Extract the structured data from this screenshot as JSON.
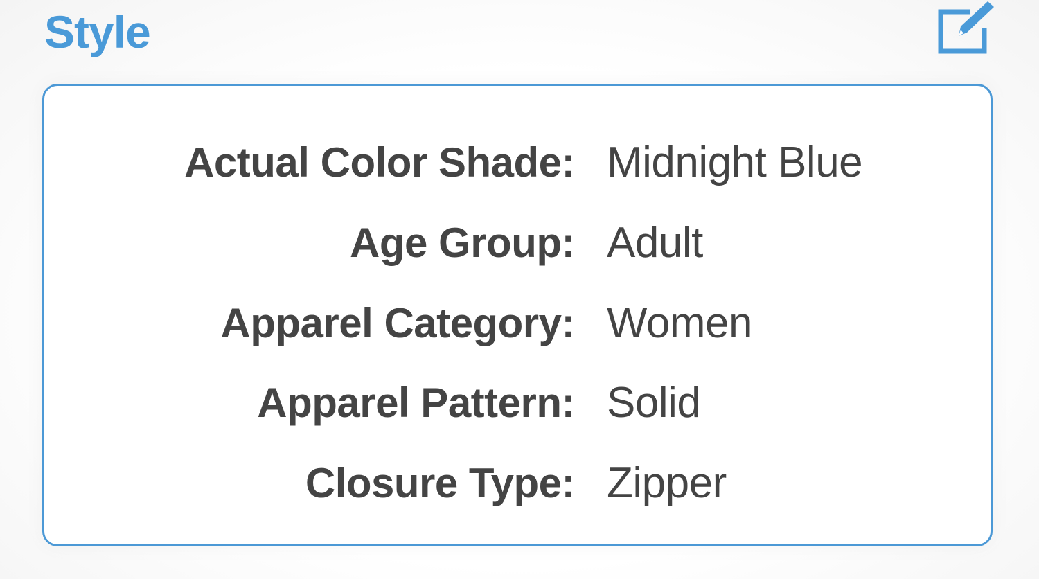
{
  "section": {
    "title": "Style"
  },
  "colors": {
    "accent": "#4a9ad8",
    "text": "#444444"
  },
  "attributes": [
    {
      "label": "Actual Color Shade:",
      "value": "Midnight Blue"
    },
    {
      "label": "Age Group:",
      "value": "Adult"
    },
    {
      "label": "Apparel Category:",
      "value": "Women"
    },
    {
      "label": "Apparel Pattern:",
      "value": "Solid"
    },
    {
      "label": "Closure Type:",
      "value": "Zipper"
    }
  ],
  "icons": {
    "edit": "edit-icon"
  }
}
